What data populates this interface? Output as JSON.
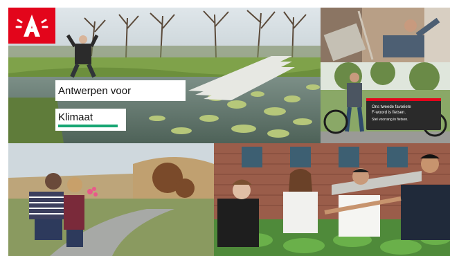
{
  "branding": {
    "logo_letter": "A",
    "logo_color": "#e3051b"
  },
  "title": {
    "line1": "Antwerpen voor",
    "line2": "Klimaat",
    "accent_color": "#17a673"
  },
  "tiles": {
    "bike": {
      "sign_line1": "Ons tweede favoriete",
      "sign_line2": "F-woord is fietsen.",
      "sign_line3": "Stel voorrang in fietsen."
    }
  }
}
